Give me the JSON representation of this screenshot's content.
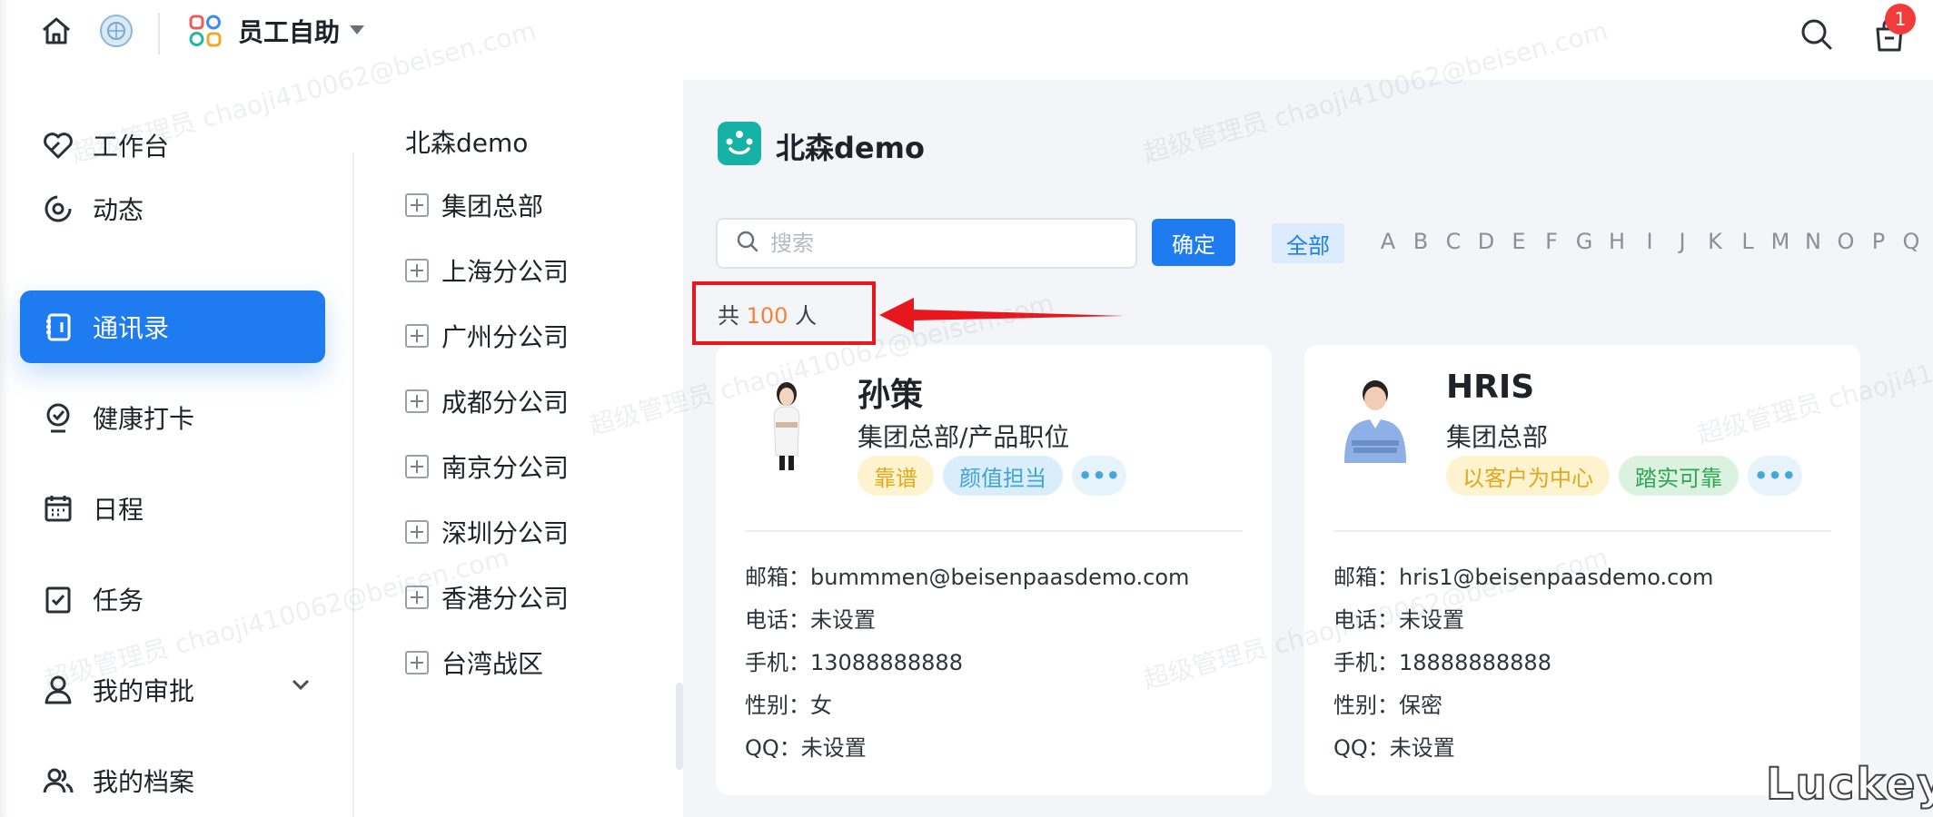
{
  "app": {
    "name": "员工自助",
    "notification_count": "1"
  },
  "watermark": "超级管理员 chaoji410062@beisen.com",
  "nav": [
    {
      "label": "工作台",
      "icon": "workbench-icon",
      "active": false
    },
    {
      "label": "动态",
      "icon": "feed-icon",
      "active": false
    },
    {
      "label": "通讯录",
      "icon": "contacts-icon",
      "active": true
    },
    {
      "label": "健康打卡",
      "icon": "health-check-icon",
      "active": false
    },
    {
      "label": "日程",
      "icon": "calendar-icon",
      "active": false
    },
    {
      "label": "任务",
      "icon": "task-icon",
      "active": false
    },
    {
      "label": "我的审批",
      "icon": "approval-icon",
      "active": false
    },
    {
      "label": "我的档案",
      "icon": "profile-icon",
      "active": false
    }
  ],
  "tree": {
    "root": "北森demo",
    "items": [
      "集团总部",
      "上海分公司",
      "广州分公司",
      "成都分公司",
      "南京分公司",
      "深圳分公司",
      "香港分公司",
      "台湾战区"
    ]
  },
  "main": {
    "org_title": "北森demo",
    "search_placeholder": "搜索",
    "confirm_label": "确定",
    "all_label": "全部",
    "letters": [
      "A",
      "B",
      "C",
      "D",
      "E",
      "F",
      "G",
      "H",
      "I",
      "J",
      "K",
      "L",
      "M",
      "N",
      "O",
      "P",
      "Q"
    ],
    "count_prefix": "共",
    "count_value": "100",
    "count_suffix": "人"
  },
  "cards": [
    {
      "name": "孙策",
      "dept": "集团总部/产品职位",
      "tags": [
        {
          "text": "靠谱",
          "color": "yellow"
        },
        {
          "text": "颜值担当",
          "color": "blue"
        }
      ],
      "more": "•••",
      "email": "邮箱：bummmen@beisenpaasdemo.com",
      "phone": "电话：未设置",
      "mobile": "手机：13088888888",
      "gender": "性别：女",
      "qq": "QQ：未设置"
    },
    {
      "name": "HRIS",
      "dept": "集团总部",
      "tags": [
        {
          "text": "以客户为中心",
          "color": "yellow"
        },
        {
          "text": "踏实可靠",
          "color": "green"
        }
      ],
      "more": "•••",
      "email": "邮箱：hris1@beisenpaasdemo.com",
      "phone": "电话：未设置",
      "mobile": "手机：18888888888",
      "gender": "性别：保密",
      "qq": "QQ：未设置"
    }
  ],
  "corner_logo": "Luckey",
  "colors": {
    "primary": "#1f7cf0",
    "highlight": "#e8171d",
    "count": "#f3823a"
  }
}
